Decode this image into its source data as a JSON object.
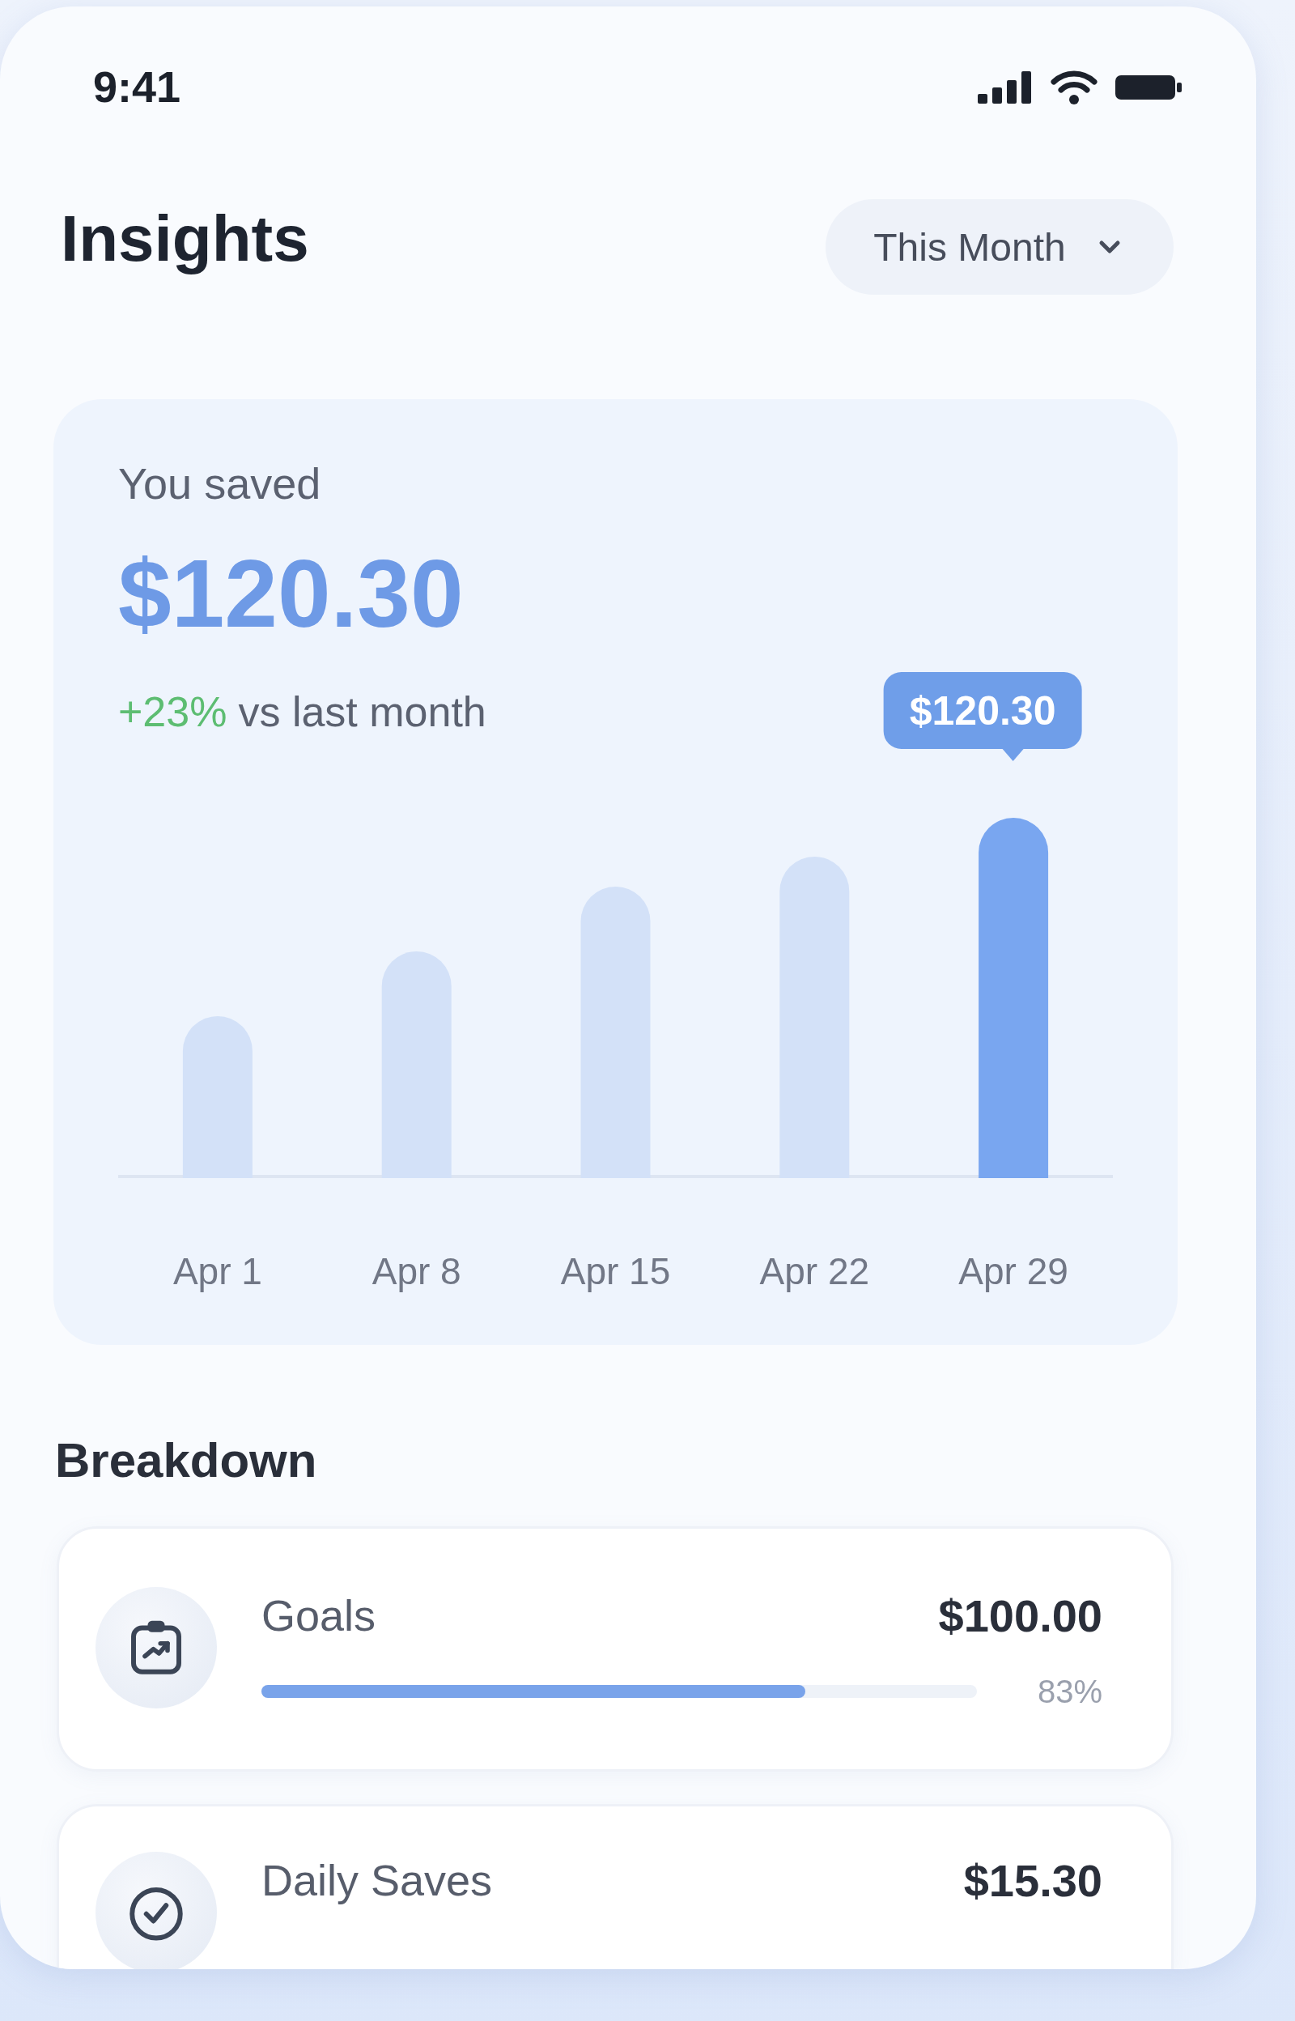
{
  "status_bar": {
    "time": "9:41"
  },
  "header": {
    "title": "Insights",
    "period": "This Month"
  },
  "summary": {
    "label": "You saved",
    "amount": "$120.30",
    "change": "+23%",
    "comparison": "vs last month"
  },
  "chart": {
    "tooltip": "$120.30",
    "bars": [
      {
        "label": "Apr 1",
        "selected": false
      },
      {
        "label": "Apr 8",
        "selected": false
      },
      {
        "label": "Apr 15",
        "selected": false
      },
      {
        "label": "Apr 22",
        "selected": false
      },
      {
        "label": "Apr 29",
        "selected": true
      }
    ]
  },
  "breakdown": {
    "title": "Breakdown",
    "items": [
      {
        "name": "Goals",
        "amount": "$100.00",
        "level": 0.76,
        "percent": "83%"
      },
      {
        "name": "Daily Saves",
        "amount": "$15.30"
      }
    ]
  }
}
